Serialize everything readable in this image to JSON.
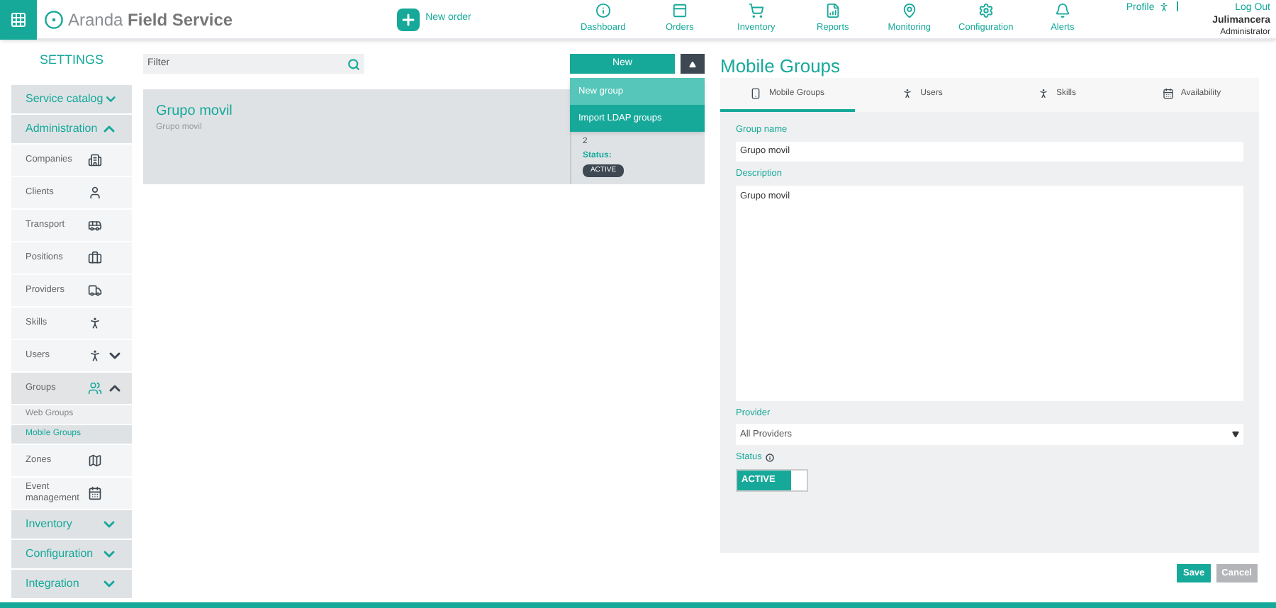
{
  "header": {
    "brand": "Aranda",
    "brand_bold": "Field Service",
    "new_order": "New order",
    "nav": [
      {
        "label": "Dashboard"
      },
      {
        "label": "Orders"
      },
      {
        "label": "Inventory"
      },
      {
        "label": "Reports"
      },
      {
        "label": "Monitoring"
      },
      {
        "label": "Configuration"
      },
      {
        "label": "Alerts"
      }
    ],
    "profile": "Profile",
    "logout": "Log Out",
    "user": "Julimancera",
    "role": "Administrator"
  },
  "sidebar": {
    "title": "SETTINGS",
    "items": [
      {
        "label": "Service catalog",
        "kind": "section",
        "expanded": false
      },
      {
        "label": "Administration",
        "kind": "section",
        "expanded": true,
        "children": [
          {
            "label": "Companies"
          },
          {
            "label": "Clients"
          },
          {
            "label": "Transport"
          },
          {
            "label": "Positions"
          },
          {
            "label": "Providers"
          },
          {
            "label": "Skills"
          },
          {
            "label": "Users",
            "expanded": false
          },
          {
            "label": "Groups",
            "expanded": true,
            "children": [
              {
                "label": "Web Groups",
                "selected": false
              },
              {
                "label": "Mobile Groups",
                "selected": true
              }
            ]
          },
          {
            "label": "Zones"
          },
          {
            "label": "Event management"
          }
        ]
      },
      {
        "label": "Inventory",
        "kind": "section",
        "expanded": false
      },
      {
        "label": "Configuration",
        "kind": "section",
        "expanded": false
      },
      {
        "label": "Integration",
        "kind": "section",
        "expanded": false
      }
    ]
  },
  "list": {
    "filter_placeholder": "Filter",
    "new_button": "New",
    "menu": [
      {
        "label": "New group",
        "selected": true
      },
      {
        "label": "Import LDAP groups",
        "selected": false
      }
    ],
    "cards": [
      {
        "title": "Grupo movil",
        "subtitle": "Grupo movil",
        "count": "2",
        "status_label": "Status:",
        "status": "ACTIVE"
      }
    ]
  },
  "detail": {
    "title": "Mobile Groups",
    "tabs": [
      {
        "label": "Mobile Groups",
        "selected": true
      },
      {
        "label": "Users",
        "selected": false
      },
      {
        "label": "Skills",
        "selected": false
      },
      {
        "label": "Availability",
        "selected": false
      }
    ],
    "group_name_label": "Group name",
    "group_name": "Grupo movil",
    "description_label": "Description",
    "description": "Grupo movil",
    "provider_label": "Provider",
    "provider": "All Providers",
    "status_label": "Status",
    "status": {
      "label": "ACTIVE",
      "on": true
    },
    "buttons": [
      {
        "label": "Save",
        "kind": "primary"
      },
      {
        "label": "Cancel",
        "kind": "secondary"
      }
    ]
  }
}
